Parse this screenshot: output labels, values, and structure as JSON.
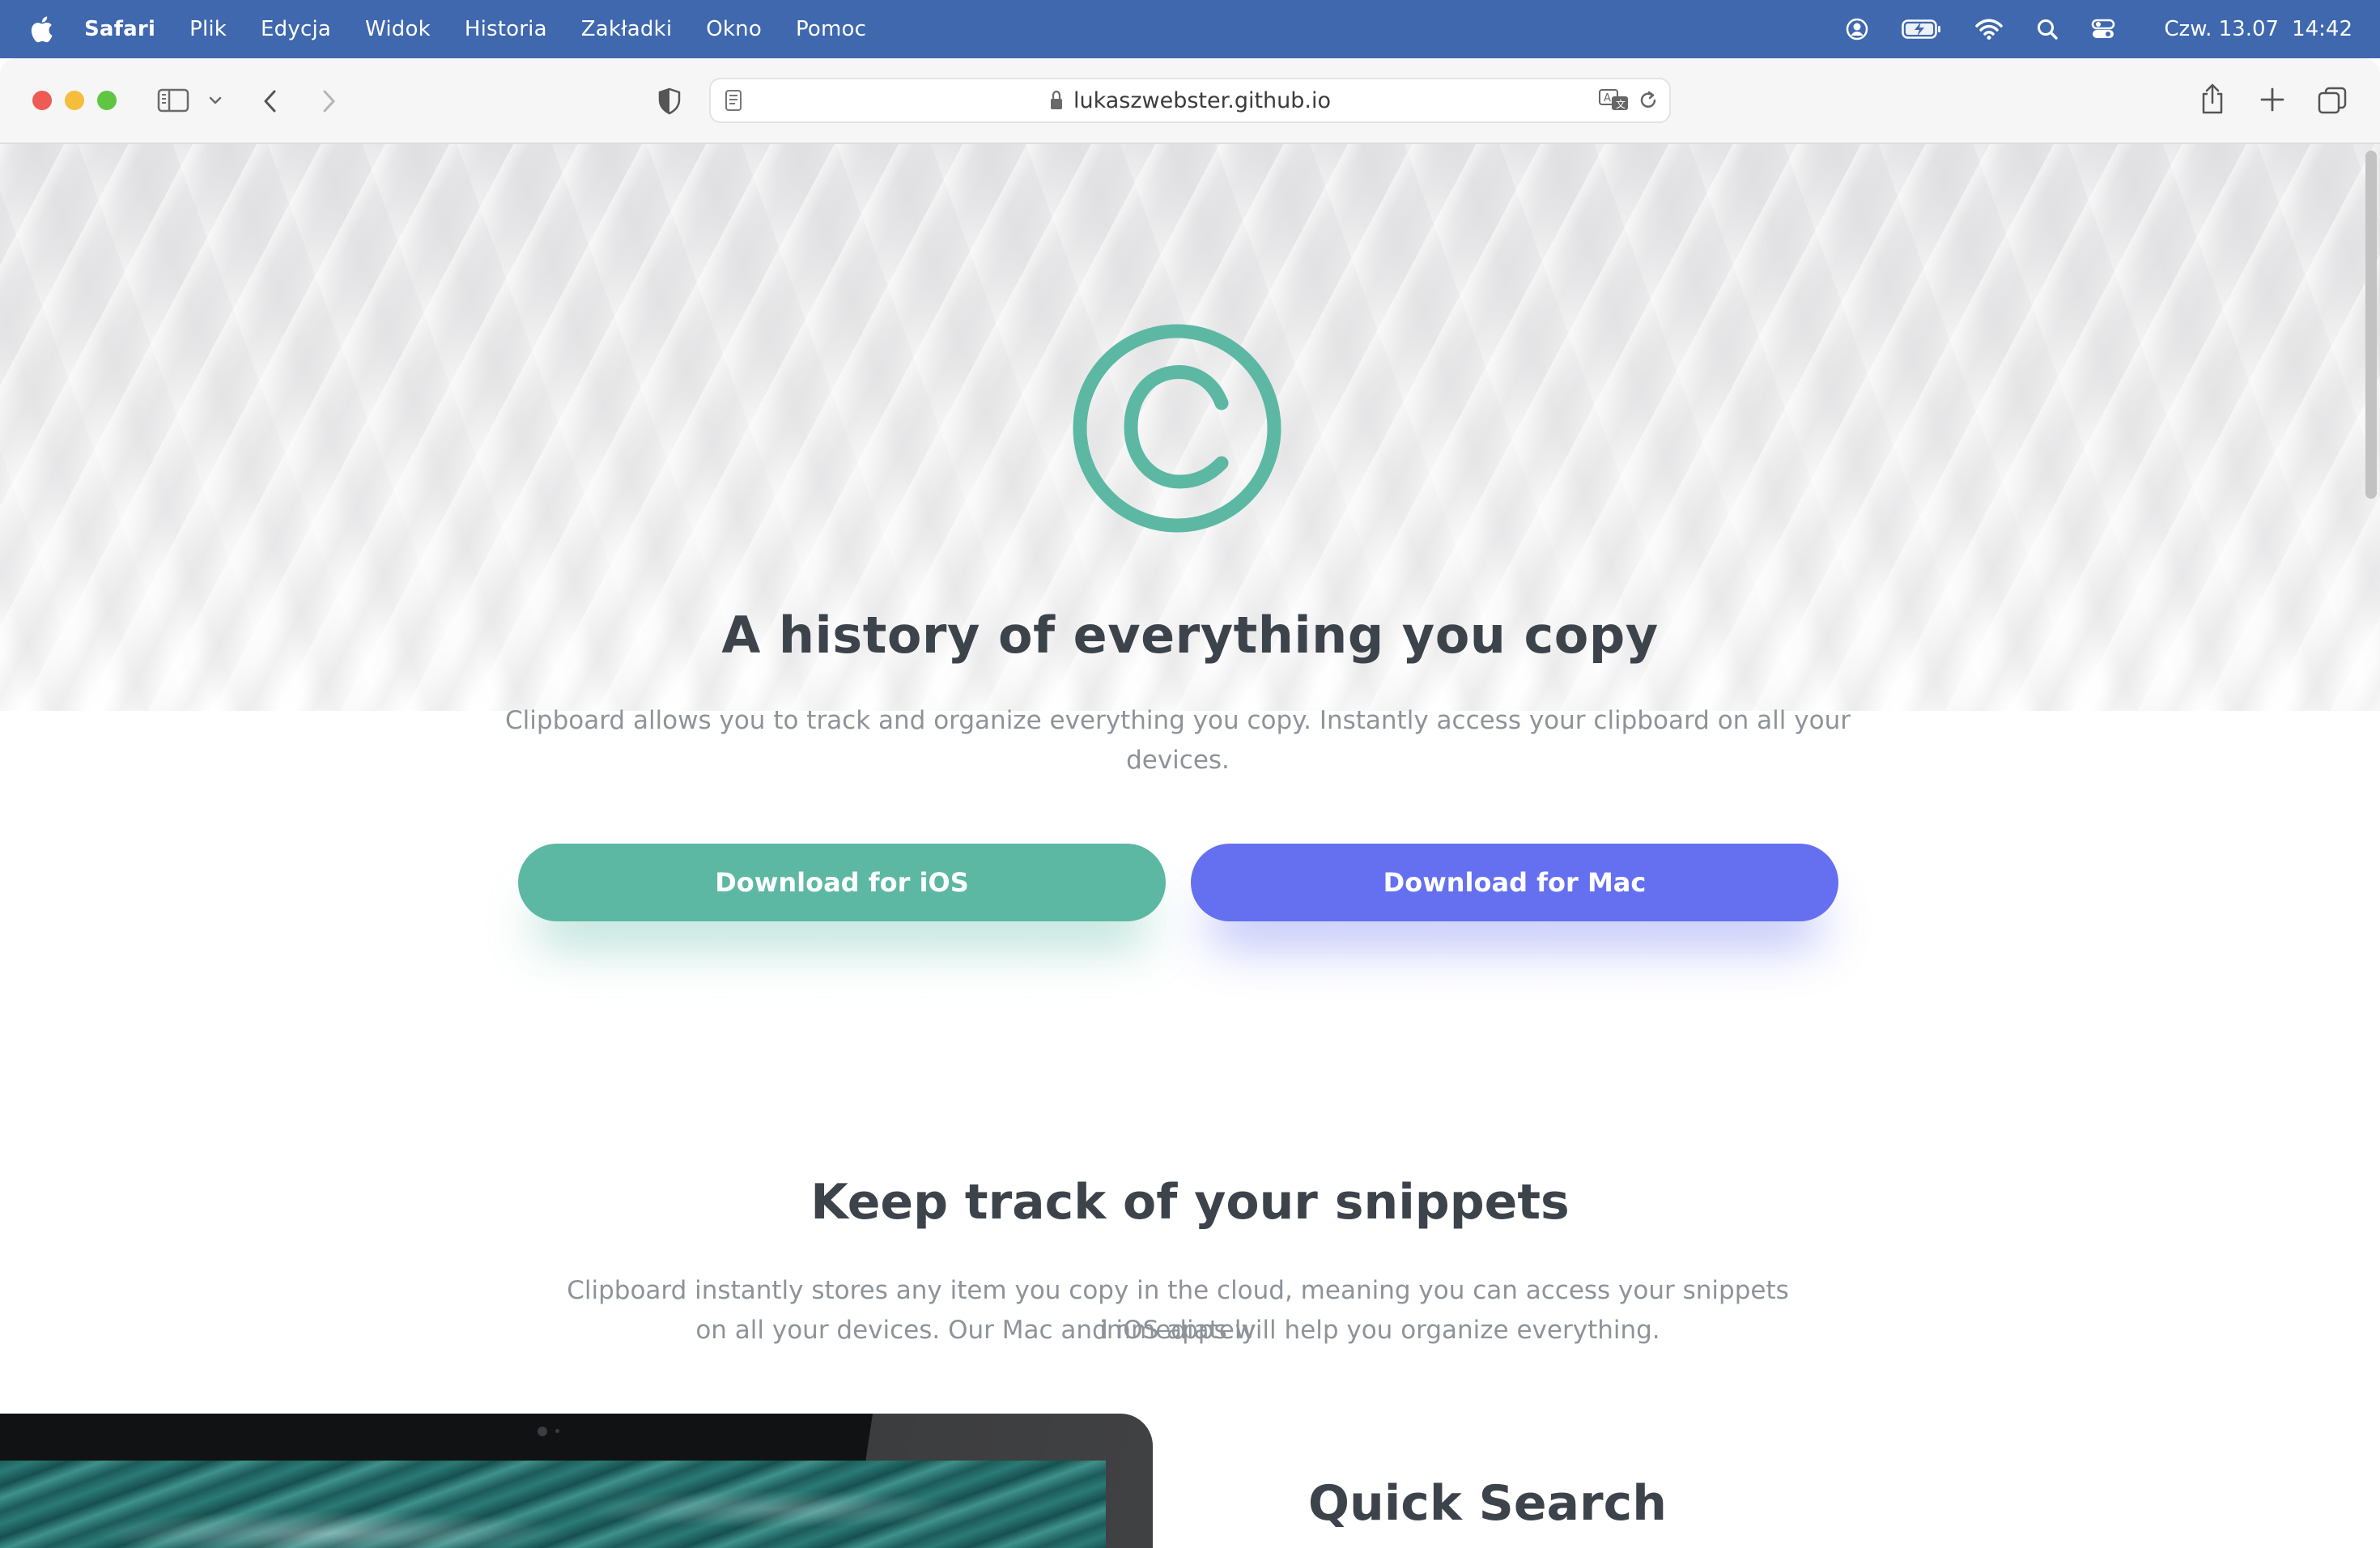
{
  "menubar": {
    "app_name": "Safari",
    "items": [
      "Plik",
      "Edycja",
      "Widok",
      "Historia",
      "Zakładki",
      "Okno",
      "Pomoc"
    ],
    "date": "Czw. 13.07",
    "time": "14:42",
    "status_icons": [
      "user-account-icon",
      "battery-charging-icon",
      "wifi-icon",
      "spotlight-search-icon",
      "control-center-icon"
    ]
  },
  "browser": {
    "url": "lukaszwebster.github.io",
    "toolbar_icons": [
      "sidebar-icon",
      "chevron-down-icon",
      "back-icon",
      "forward-icon",
      "privacy-shield-icon",
      "reader-icon",
      "lock-icon",
      "translate-icon",
      "reload-icon",
      "share-icon",
      "new-tab-icon",
      "tab-overview-icon"
    ]
  },
  "hero": {
    "logo_icon": "copyright-logo-icon",
    "title": "A history of everything you copy",
    "subtitle_line1": "Clipboard allows you to track and organize everything you copy. Instantly access your clipboard on all your",
    "subtitle_line2": "devices.",
    "ios_button": "Download for iOS",
    "mac_button": "Download for Mac"
  },
  "features": {
    "title": "Keep track of your snippets",
    "text_line1": "Clipboard instantly stores any item you copy in the cloud, meaning you can access your snippets immediately",
    "text_line2": "on all your devices. Our Mac and iOS apps will help you organize everything.",
    "quick_search_title": "Quick Search"
  },
  "colors": {
    "menubar": "#3f68ae",
    "ios_green": "#5cb8a3",
    "mac_blue": "#6470f0",
    "heading": "#3d434b",
    "body_text": "#8e939a"
  }
}
